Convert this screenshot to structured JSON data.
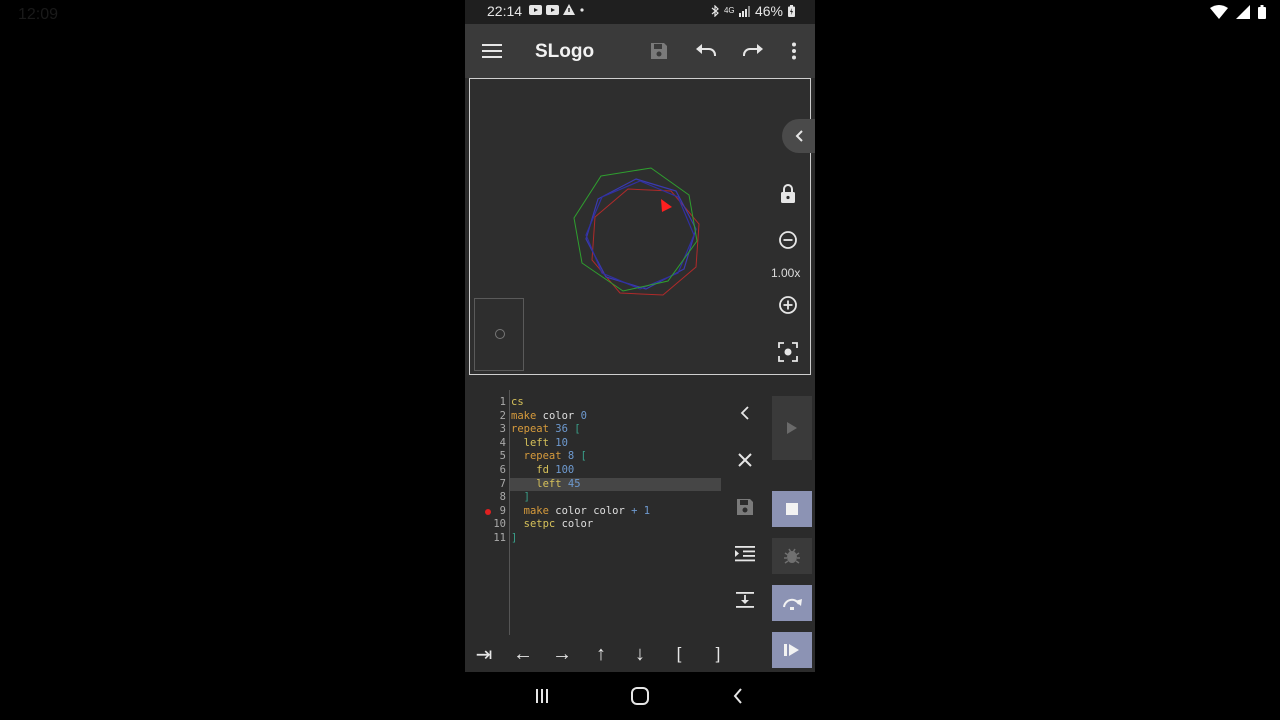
{
  "desktop": {
    "ghost_clock": "12:09"
  },
  "status_bar": {
    "time": "22:14",
    "battery": "46%",
    "network": "4G"
  },
  "app_bar": {
    "title": "SLogo"
  },
  "canvas": {
    "zoom_label": "1.00x"
  },
  "editor": {
    "lines": [
      {
        "n": "1",
        "tokens": [
          {
            "t": "cs",
            "c": "fn"
          }
        ]
      },
      {
        "n": "2",
        "tokens": [
          {
            "t": "make",
            "c": "kw"
          },
          {
            "t": " color ",
            "c": "var"
          },
          {
            "t": "0",
            "c": "num"
          }
        ]
      },
      {
        "n": "3",
        "tokens": [
          {
            "t": "repeat",
            "c": "kw"
          },
          {
            "t": " 36 ",
            "c": "num"
          },
          {
            "t": "[",
            "c": "br"
          }
        ]
      },
      {
        "n": "4",
        "tokens": [
          {
            "t": "  left",
            "c": "fn"
          },
          {
            "t": " 10",
            "c": "num"
          }
        ]
      },
      {
        "n": "5",
        "tokens": [
          {
            "t": "  repeat",
            "c": "kw"
          },
          {
            "t": " 8 ",
            "c": "num"
          },
          {
            "t": "[",
            "c": "br"
          }
        ]
      },
      {
        "n": "6",
        "tokens": [
          {
            "t": "    fd",
            "c": "fn"
          },
          {
            "t": " 100",
            "c": "num"
          }
        ]
      },
      {
        "n": "7",
        "tokens": [
          {
            "t": "    left",
            "c": "fn"
          },
          {
            "t": " 45",
            "c": "num"
          }
        ],
        "highlight": true
      },
      {
        "n": "8",
        "tokens": [
          {
            "t": "  ]",
            "c": "br"
          }
        ]
      },
      {
        "n": "9",
        "tokens": [
          {
            "t": "  make",
            "c": "kw"
          },
          {
            "t": " color color ",
            "c": "var"
          },
          {
            "t": "+ 1",
            "c": "op"
          }
        ],
        "breakpoint": true
      },
      {
        "n": "10",
        "tokens": [
          {
            "t": "  setpc",
            "c": "fn"
          },
          {
            "t": " color",
            "c": "var"
          }
        ]
      },
      {
        "n": "11",
        "tokens": [
          {
            "t": "]",
            "c": "br"
          }
        ]
      }
    ]
  },
  "keys": {
    "tab": "⇥",
    "left": "←",
    "right": "→",
    "up": "↑",
    "down": "↓",
    "open_bracket": "[",
    "close_bracket": "]"
  },
  "colors": {
    "app_bar": "#3a3a3a",
    "background": "#2b2b2b",
    "accent_button": "#8c93b4",
    "turtle": "#ff2020",
    "trail_green": "#2f9f2f",
    "trail_blue": "#3a3ab0",
    "trail_red": "#b02a2a"
  },
  "icons": {
    "app_bar": [
      "menu-icon",
      "save-icon",
      "undo-icon",
      "redo-icon",
      "more-vert-icon"
    ],
    "canvas": [
      "chevron-left-icon",
      "lock-icon",
      "zoom-out-icon",
      "zoom-in-icon",
      "center-focus-icon"
    ],
    "editor": [
      "chevron-left-icon",
      "close-icon",
      "save-icon",
      "format-indent-icon",
      "insert-icon"
    ],
    "run": [
      "play-icon",
      "stop-icon",
      "debug-icon",
      "step-over-icon",
      "step-icon"
    ],
    "nav": [
      "recents-icon",
      "home-icon",
      "back-icon"
    ]
  }
}
